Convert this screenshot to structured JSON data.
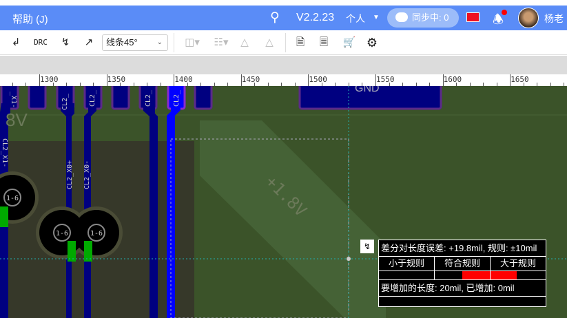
{
  "header": {
    "help": "帮助 (J)",
    "version": "V2.2.23",
    "personal": "个人",
    "sync": "同步中: 0",
    "user": "杨老"
  },
  "toolbar": {
    "drc": "DRC",
    "line_mode": "线条45°"
  },
  "ruler": {
    "labels": [
      "1300",
      "1350",
      "1400",
      "1450",
      "1500",
      "1550",
      "1600",
      "1650"
    ]
  },
  "pcb": {
    "net_18v": "+1.8V",
    "net_8v": "8V",
    "gnd": "GND",
    "labels": [
      "_X1-",
      "CL2_",
      "CL2_",
      "CL2_",
      "CL2_",
      "CL2_X1-",
      "CL2_X0+",
      "CL2_X0-"
    ],
    "pad": "1-6"
  },
  "tooltip": {
    "title": "差分对长度误差: +19.8mil, 规则: ±10mil",
    "less": "小于规则",
    "ok": "符合规则",
    "more": "大于规则",
    "footer": "要增加的长度: 20mil, 已增加: 0mil",
    "status_color": "#ff0000"
  }
}
